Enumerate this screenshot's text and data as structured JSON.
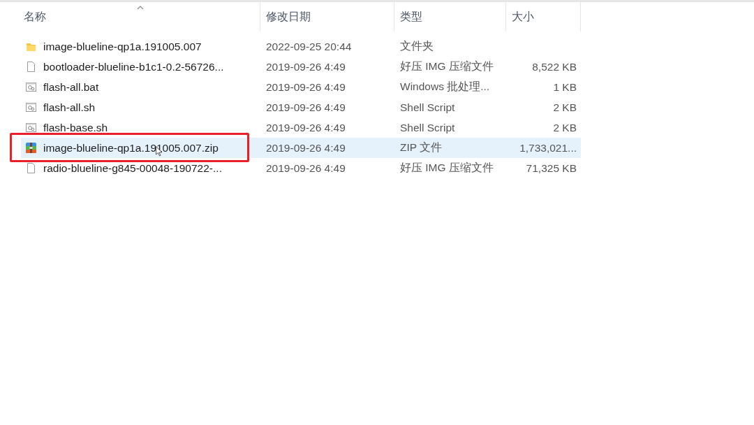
{
  "columns": [
    {
      "label": "名称",
      "sorted": true
    },
    {
      "label": "修改日期",
      "sorted": false
    },
    {
      "label": "类型",
      "sorted": false
    },
    {
      "label": "大小",
      "sorted": false
    }
  ],
  "files": [
    {
      "kind": "folder",
      "name": "image-blueline-qp1a.191005.007",
      "modified": "2022-09-25 20:44",
      "type": "文件夹",
      "selected": false,
      "annotated": false,
      "cursor": false
    },
    {
      "kind": "file",
      "name": "bootloader-blueline-b1c1-0.2-56726...",
      "modified": "2019-09-26 4:49",
      "type": "好压 IMG 压缩文件",
      "size": "8,522 KB",
      "selected": false,
      "annotated": false,
      "cursor": false
    },
    {
      "kind": "script",
      "name": "flash-all.bat",
      "modified": "2019-09-26 4:49",
      "type": "Windows 批处理...",
      "size": "1 KB",
      "selected": false,
      "annotated": false,
      "cursor": false
    },
    {
      "kind": "script",
      "name": "flash-all.sh",
      "modified": "2019-09-26 4:49",
      "type": "Shell Script",
      "size": "2 KB",
      "selected": false,
      "annotated": false,
      "cursor": false
    },
    {
      "kind": "script",
      "name": "flash-base.sh",
      "modified": "2019-09-26 4:49",
      "type": "Shell Script",
      "size": "2 KB",
      "selected": false,
      "annotated": false,
      "cursor": false
    },
    {
      "kind": "archive",
      "name": "image-blueline-qp1a.191005.007.zip",
      "modified": "2019-09-26 4:49",
      "type": "ZIP 文件",
      "size": "1,733,021...",
      "selected": true,
      "annotated": true,
      "cursor": true
    },
    {
      "kind": "file",
      "name": "radio-blueline-g845-00048-190722-...",
      "modified": "2019-09-26 4:49",
      "type": "好压 IMG 压缩文件",
      "size": "71,325 KB",
      "selected": false,
      "annotated": false,
      "cursor": false
    }
  ]
}
